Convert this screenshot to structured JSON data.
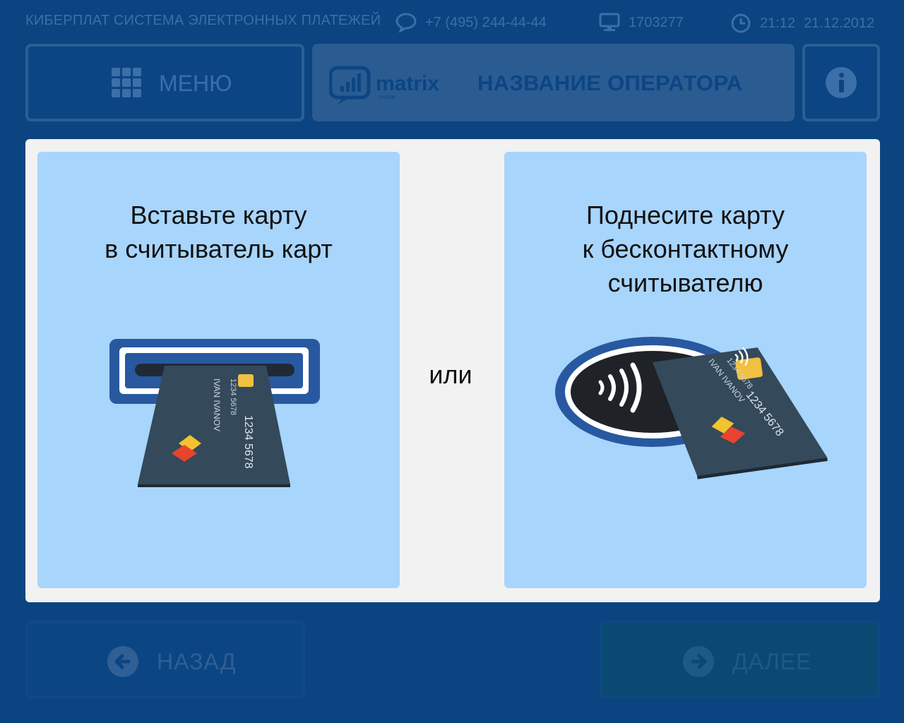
{
  "status": {
    "brand": "КИБЕРПЛАТ СИСТЕМА ЭЛЕКТРОННЫХ ПЛАТЕЖЕЙ",
    "phone": "+7 (495) 244-44-44",
    "terminal_id": "1703277",
    "time": "21:12",
    "date": "21.12.2012"
  },
  "header": {
    "menu_label": "МЕНЮ",
    "logo_text": "matrix",
    "logo_sub": "mobile",
    "operator_name": "НАЗВАНИЕ ОПЕРАТОРА"
  },
  "main": {
    "insert_text_line1": "Вставьте карту",
    "insert_text_line2": "в считыватель карт",
    "or_text": "или",
    "tap_text_line1": "Поднесите карту",
    "tap_text_line2": "к бесконтактному",
    "tap_text_line3": "считывателю",
    "card": {
      "name": "IVAN IVANOV",
      "number_small": "1234  5678",
      "number_large": "1234  5678"
    }
  },
  "footer": {
    "back_label": "НАЗАД",
    "next_label": "ДАЛЕЕ"
  },
  "colors": {
    "background": "#0b4480",
    "panel": "#f2f2f2",
    "card_box": "#a8d5fc",
    "card": "#34495a",
    "chip": "#f0c040",
    "accent_blue": "#2859a0"
  }
}
